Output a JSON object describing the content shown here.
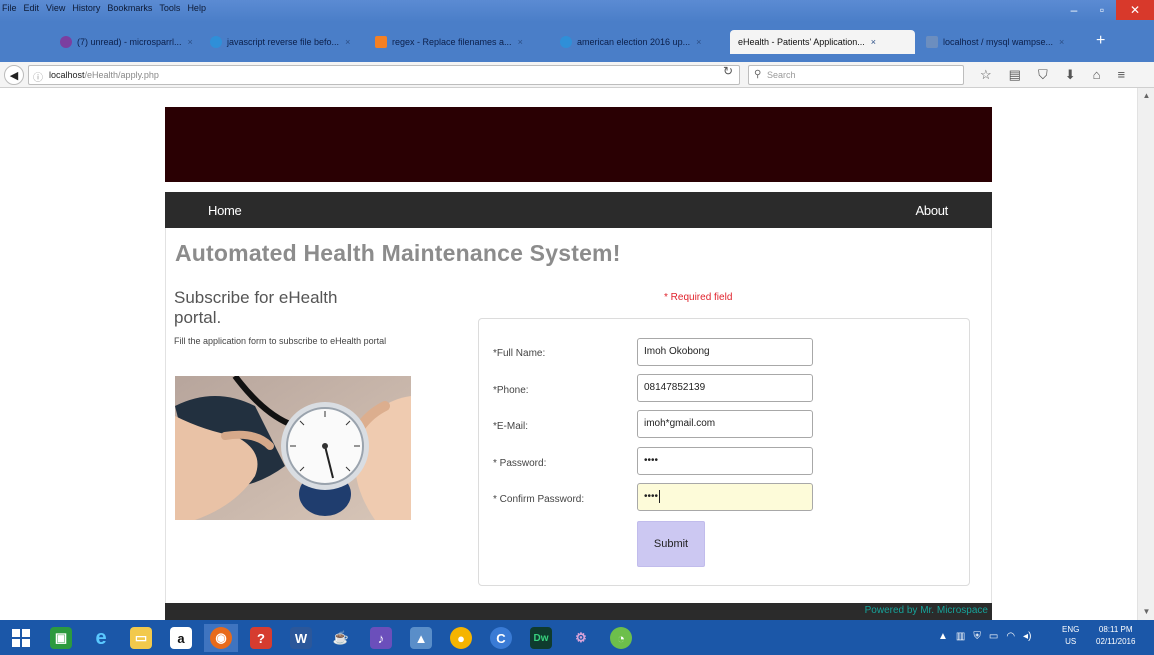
{
  "browser": {
    "menu": [
      "File",
      "Edit",
      "View",
      "History",
      "Bookmarks",
      "Tools",
      "Help"
    ],
    "tabs": [
      {
        "label": "(7) unread) - microsparrl...",
        "color": "#7b3fa0"
      },
      {
        "label": "javascript reverse file befo...",
        "color": "#2f8fd8"
      },
      {
        "label": "regex - Replace filenames a...",
        "color": "#f48024"
      },
      {
        "label": "american election 2016 up...",
        "color": "#2f8fd8"
      },
      {
        "label": "eHealth - Patients' Application...",
        "color": "#ffffff"
      },
      {
        "label": "localhost / mysql wampse...",
        "color": "#6c8ebf"
      }
    ],
    "url_host": "localhost",
    "url_path": "/eHealth/apply.php",
    "search_placeholder": "Search"
  },
  "site": {
    "nav_home": "Home",
    "nav_about": "About",
    "main_title": "Automated Health Maintenance System!",
    "sub_title": "Subscribe for eHealth portal.",
    "sub_desc": "Fill the application form to subscribe to eHealth portal",
    "required_note": "* Required field",
    "form": {
      "full_name_label": "*Full Name:",
      "full_name_value": "Imoh Okobong",
      "phone_label": "*Phone:",
      "phone_value": "08147852139",
      "email_label": "*E-Mail:",
      "email_value": "imoh*gmail.com",
      "password_label": "* Password:",
      "password_value": "••••",
      "confirm_label": "* Confirm Password:",
      "confirm_value": "••••",
      "submit_label": "Submit"
    },
    "footer_text": "Powered by Mr. Microspace"
  },
  "taskbar": {
    "lang_top": "ENG",
    "lang_bottom": "US",
    "time": "08:11 PM",
    "date": "02/11/2016"
  }
}
